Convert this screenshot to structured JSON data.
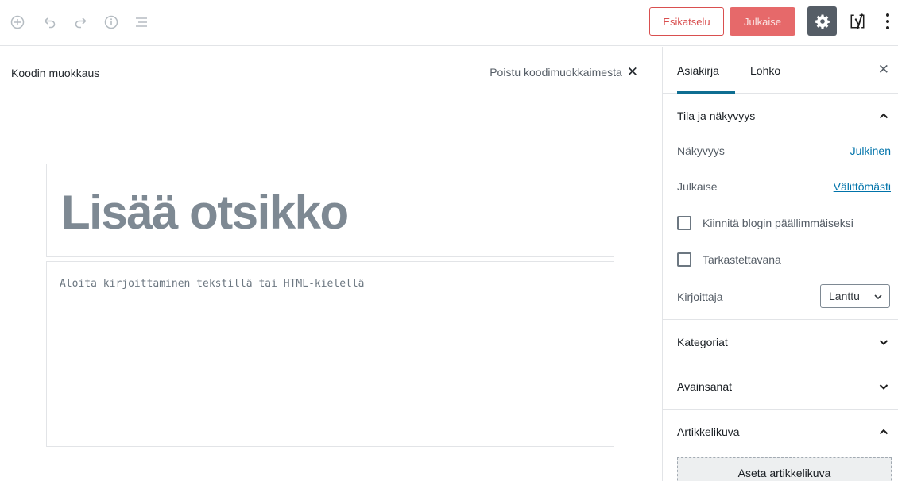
{
  "toolbar": {
    "icons": [
      "add-block-icon",
      "undo-icon",
      "redo-icon",
      "info-icon",
      "block-navigation-icon"
    ],
    "preview_label": "Esikatselu",
    "publish_label": "Julkaise",
    "settings_icon": "gear-icon",
    "yoast_icon": "yoast-icon",
    "more_icon": "more-vertical-icon",
    "colors": {
      "accent": "#d94f4f",
      "publish_bg": "#e6696a",
      "settings_bg": "#555d66"
    }
  },
  "code_editor": {
    "heading": "Koodin muokkaus",
    "exit_label": "Poistu koodimuokkaimesta",
    "title_placeholder": "Lisää otsikko",
    "content_placeholder": "Aloita kirjoittaminen tekstillä tai HTML-kielellä"
  },
  "sidebar": {
    "tabs": [
      {
        "label": "Asiakirja",
        "active": true
      },
      {
        "label": "Lohko",
        "active": false
      }
    ],
    "status_panel": {
      "title": "Tila ja näkyvyys",
      "expanded": true,
      "visibility_label": "Näkyvyys",
      "visibility_value": "Julkinen",
      "publish_label": "Julkaise",
      "publish_value": "Välittömästi",
      "sticky_label": "Kiinnitä blogin päällimmäiseksi",
      "pending_label": "Tarkastettavana",
      "author_label": "Kirjoittaja",
      "author_value": "Lanttu"
    },
    "categories_title": "Kategoriat",
    "tags_title": "Avainsanat",
    "featured_image": {
      "title": "Artikkelikuva",
      "button_label": "Aseta artikkelikuva"
    }
  }
}
